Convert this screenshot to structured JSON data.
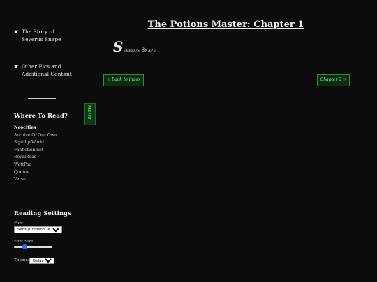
{
  "sidebar": {
    "items": [
      {
        "label": "The Story of Severus Snape"
      },
      {
        "label": "Other Fics and Additional Content"
      }
    ],
    "pointer_glyph": "☛",
    "where_title": "Where To Read?",
    "where_list": [
      "Neocities",
      "Archive Of Our Own",
      "SquidgeWorld",
      "Fanfiction.net",
      "RoyalRoad",
      "WattPad",
      "Quotev",
      "Verse"
    ],
    "settings": {
      "title": "Reading Settings",
      "font_label": "Font:",
      "font_value": "Serif (Crimson Text)",
      "font_size_label": "Font Size:",
      "font_size_fraction": 0.25,
      "theme_label": "Theme:",
      "theme_value": "Default"
    }
  },
  "menu_tab": {
    "label": "MENU"
  },
  "main": {
    "title": "The Potions Master: Chapter 1",
    "author_initial": "S",
    "author_rest": "everus Snape",
    "back_button": "☜ Back to index",
    "next_button": "Chapter 2 ☞"
  },
  "colors": {
    "background": "#0c0c0c",
    "button_bg": "#0d2d12",
    "button_border": "#2f8a3d",
    "button_text": "#9ee6a8",
    "slider_thumb": "#1a73e8"
  },
  "icons": {
    "sidebar_pointer": "pointing-hand-icon"
  }
}
